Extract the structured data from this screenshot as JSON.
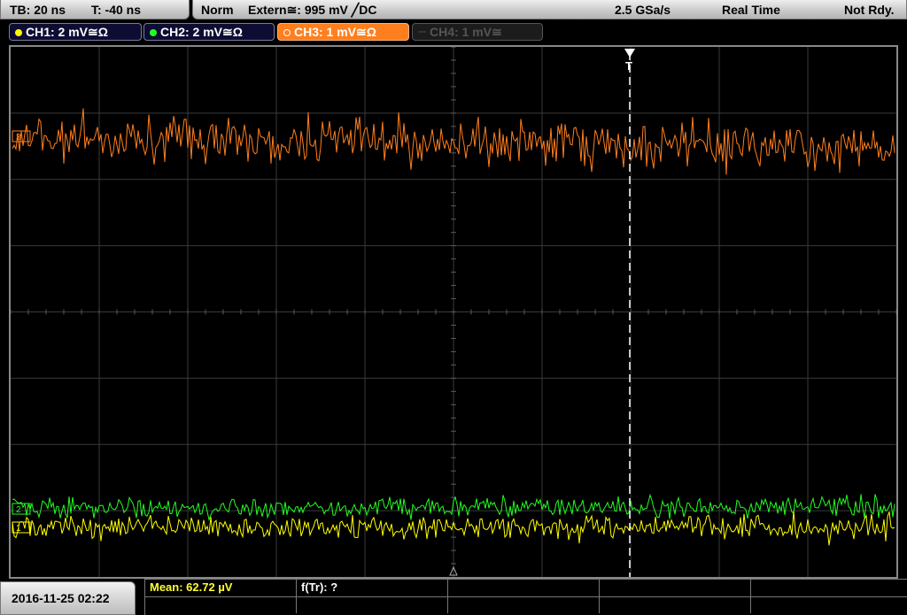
{
  "topbar": {
    "timebase": "TB: 20 ns",
    "trigger_time": "T: -40 ns",
    "trigger_mode": "Norm",
    "trigger_source": "Extern≅: 995 mV ╱DC",
    "sample_rate": "2.5 GSa/s",
    "acq_mode": "Real Time",
    "status": "Not Rdy."
  },
  "channels": [
    {
      "label": "CH1: 2 mV≅Ω",
      "color": "#ffff00",
      "state": "on"
    },
    {
      "label": "CH2: 2 mV≅Ω",
      "color": "#22ff22",
      "state": "on"
    },
    {
      "label": "CH3: 1 mV≅Ω",
      "color": "#ff7f1e",
      "state": "selected"
    },
    {
      "label": "CH4: 1 mV≅",
      "color": "#555555",
      "state": "off"
    }
  ],
  "markers": {
    "ch3": "3",
    "ch1": "1",
    "ch2": "2",
    "trigger": "T"
  },
  "bottom": {
    "datetime": "2016-11-25 02:22",
    "mean": "Mean: 62.72 µV",
    "rise_freq": "f(Tr): ?"
  },
  "colors": {
    "ch1": "#ffff00",
    "ch2": "#22ff22",
    "ch3": "#ff7f1e",
    "grid": "#3a3a3a",
    "background": "#000000"
  }
}
